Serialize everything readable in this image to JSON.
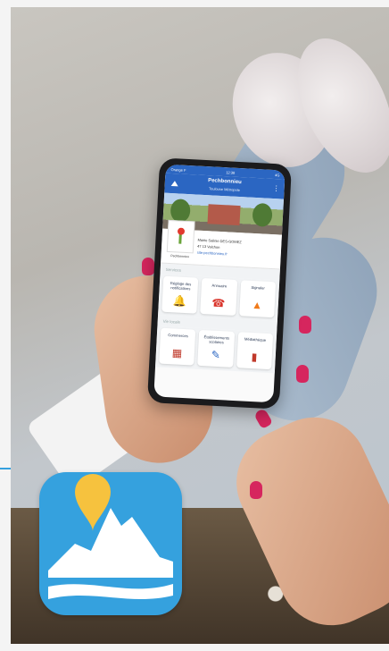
{
  "phone": {
    "status_left": "Orange F",
    "status_time": "12:38",
    "status_right": "4G",
    "app_title": "Pechbonnieu",
    "app_subtitle": "Toulouse Métropole",
    "crest_tag": "Pechbonnieu",
    "contact_lines": [
      "Mairie Salinie DES-GOMEZ",
      "47 13 Valchon",
      "site-pechbonnieu.fr"
    ],
    "section_1": "Services",
    "section_2": "Vie locale",
    "tiles_row1": [
      {
        "label": "Réglage des notifications",
        "icon": "bell-icon"
      },
      {
        "label": "Annuaire",
        "icon": "phone-icon"
      },
      {
        "label": "Signaler",
        "icon": "cone-icon"
      }
    ],
    "tiles_row2": [
      {
        "label": "Commerces",
        "icon": "shop-icon"
      },
      {
        "label": "Établissements scolaires",
        "icon": "school-icon"
      },
      {
        "label": "Médiathèque",
        "icon": "book-icon"
      }
    ]
  },
  "colors": {
    "brand_blue": "#2b66c2",
    "icon_blue": "#35a1de",
    "pin_yellow": "#f6c23e",
    "nail_pink": "#d6265e"
  }
}
